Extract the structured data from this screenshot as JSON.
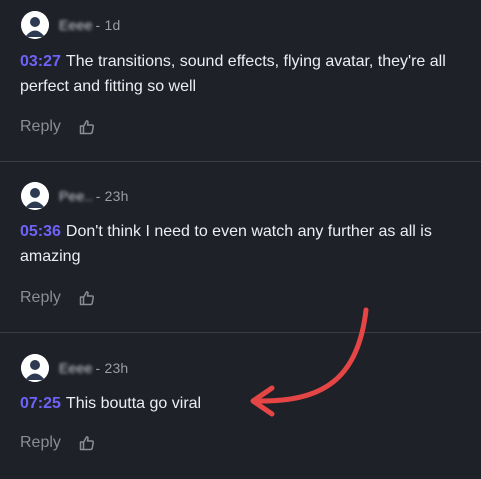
{
  "comments": [
    {
      "author": "Eeee",
      "age": "- 1d",
      "timestamp": "03:27",
      "text": "The transitions, sound effects, flying avatar, they're all perfect and fitting so well",
      "reply_label": "Reply"
    },
    {
      "author": "Pee..",
      "age": "- 23h",
      "timestamp": "05:36",
      "text": "Don't think I need to even watch any further as all is amazing",
      "reply_label": "Reply"
    },
    {
      "author": "Eeee",
      "age": "- 23h",
      "timestamp": "07:25",
      "text": "This boutta go viral",
      "reply_label": "Reply"
    }
  ],
  "colors": {
    "background": "#1f2129",
    "timestamp": "#6d63f6",
    "arrow": "#e64545",
    "muted": "#8a8d96"
  },
  "icons": {
    "avatar": "default-user-avatar-icon",
    "like": "thumbs-up-icon",
    "annotation": "red-curved-arrow"
  }
}
